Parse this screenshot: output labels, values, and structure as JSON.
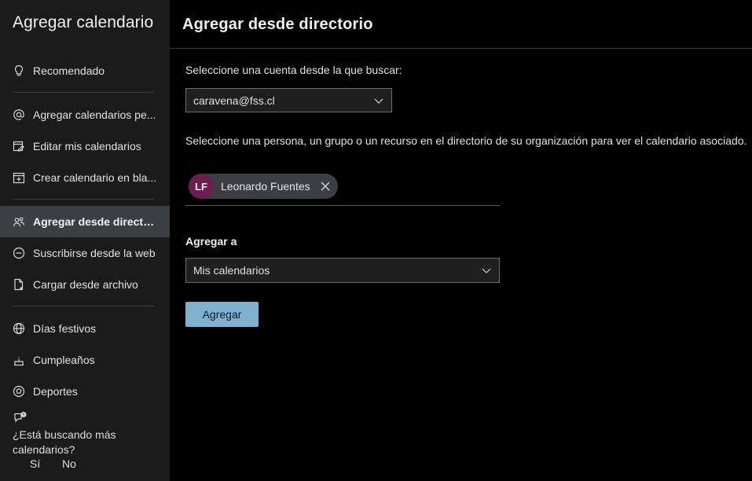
{
  "sidebar": {
    "title": "Agregar calendario",
    "items": [
      {
        "label": "Recomendado",
        "icon": "lightbulb-icon"
      },
      {
        "label": "Agregar calendarios pe...",
        "icon": "at-sign-icon"
      },
      {
        "label": "Editar mis calendarios",
        "icon": "edit-calendar-icon"
      },
      {
        "label": "Crear calendario en bla...",
        "icon": "new-calendar-icon"
      },
      {
        "label": "Agregar desde director...",
        "icon": "people-icon",
        "active": true
      },
      {
        "label": "Suscribirse desde la web",
        "icon": "link-icon"
      },
      {
        "label": "Cargar desde archivo",
        "icon": "file-upload-icon"
      },
      {
        "label": "Días festivos",
        "icon": "globe-icon"
      },
      {
        "label": "Cumpleaños",
        "icon": "cake-icon"
      },
      {
        "label": "Deportes",
        "icon": "sports-ball-icon"
      }
    ],
    "feedback": {
      "question": "¿Está buscando más calendarios?",
      "yes": "Sí",
      "no": "No"
    }
  },
  "main": {
    "title": "Agregar desde directorio",
    "account_prompt": "Seleccione una cuenta desde la que buscar:",
    "account_value": "caravena@fss.cl",
    "directory_prompt": "Seleccione una persona, un grupo o un recurso en el directorio de su organización para ver el calendario asociado.",
    "selected_person": {
      "initials": "LF",
      "name": "Leonardo Fuentes"
    },
    "add_to_label": "Agregar a",
    "add_to_value": "Mis calendarios",
    "add_button": "Agregar"
  },
  "colors": {
    "sidebar_bg": "#1b1b1b",
    "active_item_bg": "#3b3f44",
    "avatar_bg": "#6b1f4f",
    "primary_button": "#7fb0cf"
  }
}
